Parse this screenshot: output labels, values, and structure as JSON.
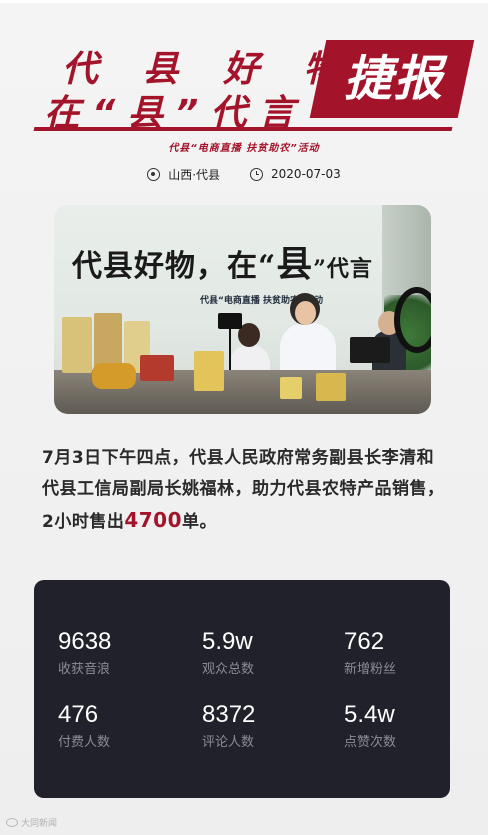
{
  "header": {
    "title_line1": "代 县 好 物",
    "title_line2": "在“县”代言",
    "badge": "捷报",
    "subtitle": "代县“电商直播 扶贫助农”活动",
    "location": "山西·代县",
    "date": "2020-07-03",
    "location_icon": "location-pin-icon",
    "date_icon": "clock-icon"
  },
  "photo": {
    "banner_main_part1": "代县好物，在“",
    "banner_main_big": "县",
    "banner_main_part2": "”代言",
    "banner_sub": "代县“电商直播 扶贫助农”活动"
  },
  "body": {
    "text_before": "7月3日下午四点，代县人民政府常务副县长李清和代县工信局副局长姚福林，助力代县农特产品销售，2小时售出",
    "highlight": "4700",
    "text_after": "单。"
  },
  "stats": [
    {
      "value": "9638",
      "label": "收获音浪"
    },
    {
      "value": "5.9w",
      "label": "观众总数"
    },
    {
      "value": "762",
      "label": "新增粉丝"
    },
    {
      "value": "476",
      "label": "付费人数"
    },
    {
      "value": "8372",
      "label": "评论人数"
    },
    {
      "value": "5.4w",
      "label": "点赞次数"
    }
  ],
  "watermark": "大同新闻",
  "colors": {
    "accent": "#a3142b",
    "panel": "#20212a",
    "background": "#f2f2f2"
  }
}
